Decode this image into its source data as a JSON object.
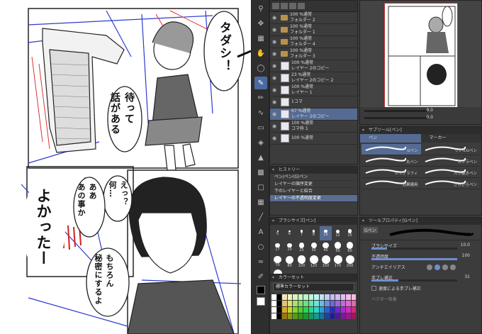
{
  "canvas": {
    "speech": {
      "tadashi": "タダシ！",
      "matte": "待って\n話がある",
      "e": "えっ？\n何…",
      "aa": "ああ\nあの事か",
      "yokatta": "よかったー",
      "mochiron": "もちろん\n秘密にするよ"
    }
  },
  "layers": {
    "rows": [
      {
        "mode": "100 %通常",
        "name": "フォルダー 2",
        "type": "folder"
      },
      {
        "mode": "100 %通常",
        "name": "フォルダー 1",
        "type": "folder"
      },
      {
        "mode": "100 %通常",
        "name": "フォルダー 4",
        "type": "folder"
      },
      {
        "mode": "100 %通常",
        "name": "フォルダー 3",
        "type": "folder"
      },
      {
        "mode": "100 %通常",
        "name": "レイヤー 2のコピー",
        "type": "layer"
      },
      {
        "mode": "23 %通常",
        "name": "レイヤー 2のコピー 2",
        "type": "layer"
      },
      {
        "mode": "100 %通常",
        "name": "レイヤー 1",
        "type": "layer"
      },
      {
        "mode": "1コマ",
        "name": "",
        "type": "frame"
      },
      {
        "mode": "67 %通常",
        "name": "レイヤー 2のコピー",
        "type": "layer",
        "selected": true
      },
      {
        "mode": "100 %通常",
        "name": "コマ枠 1",
        "type": "frame"
      },
      {
        "mode": "100 %通常",
        "name": "",
        "type": "layer"
      }
    ]
  },
  "history": {
    "title": "ヒストリー",
    "items": [
      "ペン/ペン(G)ペン",
      "レイヤーの順序変更",
      "下のレイヤーと結合",
      "レイヤーの不透明度変更"
    ]
  },
  "navigator": {
    "zoom": "9.0",
    "angle": "0.0"
  },
  "subtool": {
    "title": "サブツール[ペン]",
    "tabs": [
      "ペン",
      "マーカー"
    ],
    "items": [
      "Gペン",
      "リアルGペン",
      "丸ペン",
      "カブラペン",
      "カリグラフィ",
      "入り抜きペン",
      "効果線用",
      "さらさらペン"
    ]
  },
  "brushsize": {
    "title": "ブラシサイズ[ペン]",
    "sizes": [
      "5",
      "6",
      "7",
      "8",
      "10",
      "12",
      "15",
      "17",
      "20",
      "25",
      "30",
      "40",
      "50",
      "60",
      "70",
      "80",
      "100",
      "120",
      "150",
      "170",
      "200",
      "250"
    ]
  },
  "toolprops": {
    "title": "ツールプロパティ[Gペン]",
    "label": "Gペン",
    "brush_size_label": "ブラシサイズ",
    "brush_size_value": "10.0",
    "opacity_label": "不透明度",
    "opacity_value": "100",
    "antialias_label": "アンチエイリアス",
    "stabilize_label": "手ブレ補正",
    "stabilize_value": "31",
    "speed_label": "速度による手ブレ補正",
    "vector_label": "ベクター吸着"
  },
  "colorset": {
    "title": "カラーセット",
    "preset": "標準カラーセット"
  },
  "colors": {
    "main": "#000000",
    "sub": "#ffffff",
    "accent": "#556b93"
  }
}
